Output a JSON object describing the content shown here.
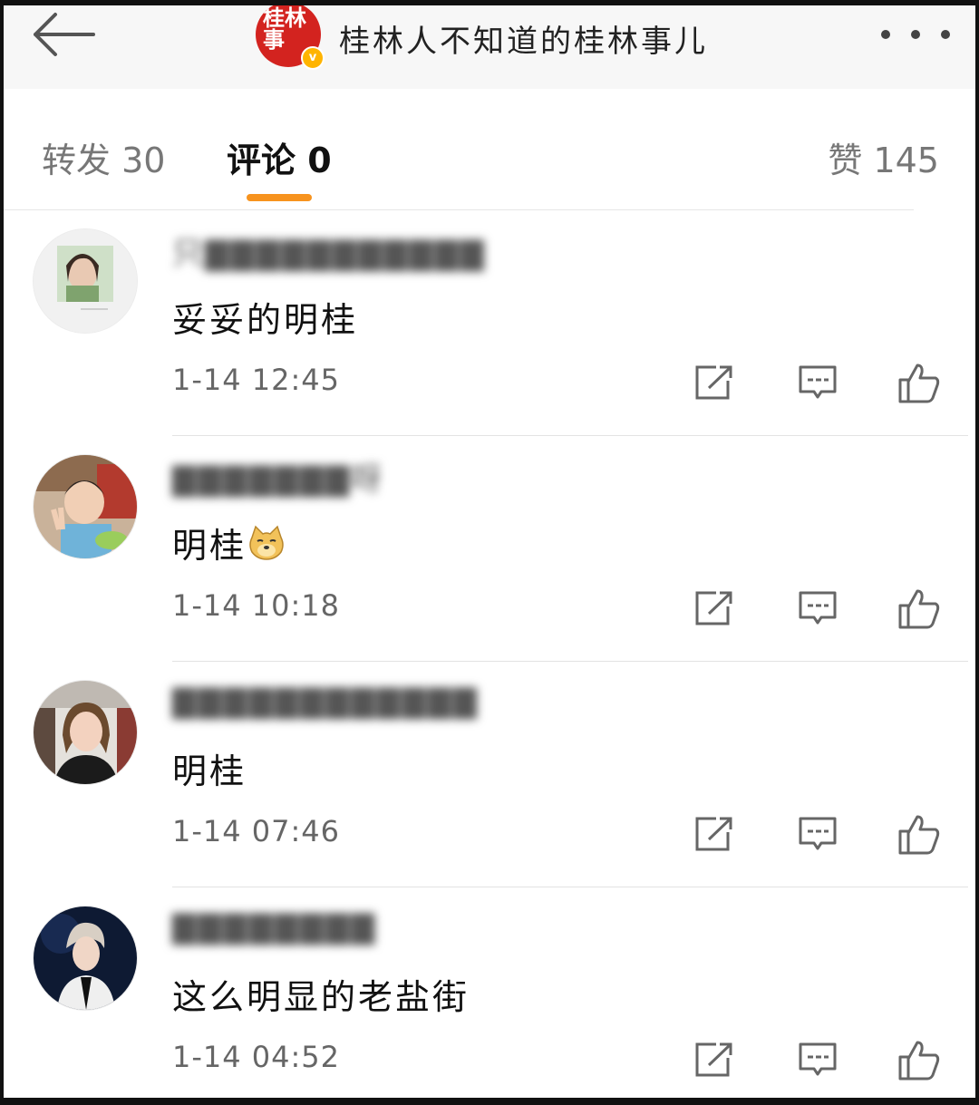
{
  "header": {
    "title": "桂林人不知道的桂林事儿",
    "logo_text": "桂林事",
    "verified_badge": "v",
    "back_icon": "back-arrow-icon",
    "more_icon": "more-dots-icon"
  },
  "tabs": {
    "repost": "转发 30",
    "comment": "评论 0",
    "like": "赞 145"
  },
  "colors": {
    "accent": "#f7931e",
    "logo_red": "#d3231f",
    "badge_yellow": "#ffb400"
  },
  "comments": [
    {
      "username": "只▇▇▇▇▇▇▇▇▇▇▇",
      "text": "妥妥的明桂",
      "emoji": "",
      "time": "1-14 12:45"
    },
    {
      "username": "▇▇▇▇▇▇▇呀",
      "text": "明桂",
      "emoji": "doge",
      "time": "1-14 10:18"
    },
    {
      "username": "▇▇▇▇▇▇▇▇▇▇▇▇",
      "text": "明桂",
      "emoji": "",
      "time": "1-14 07:46"
    },
    {
      "username": "▇▇▇▇▇▇▇▇",
      "text": "这么明显的老盐街",
      "emoji": "",
      "time": "1-14 04:52"
    }
  ],
  "action_icons": [
    "share-icon",
    "reply-icon",
    "like-icon"
  ]
}
